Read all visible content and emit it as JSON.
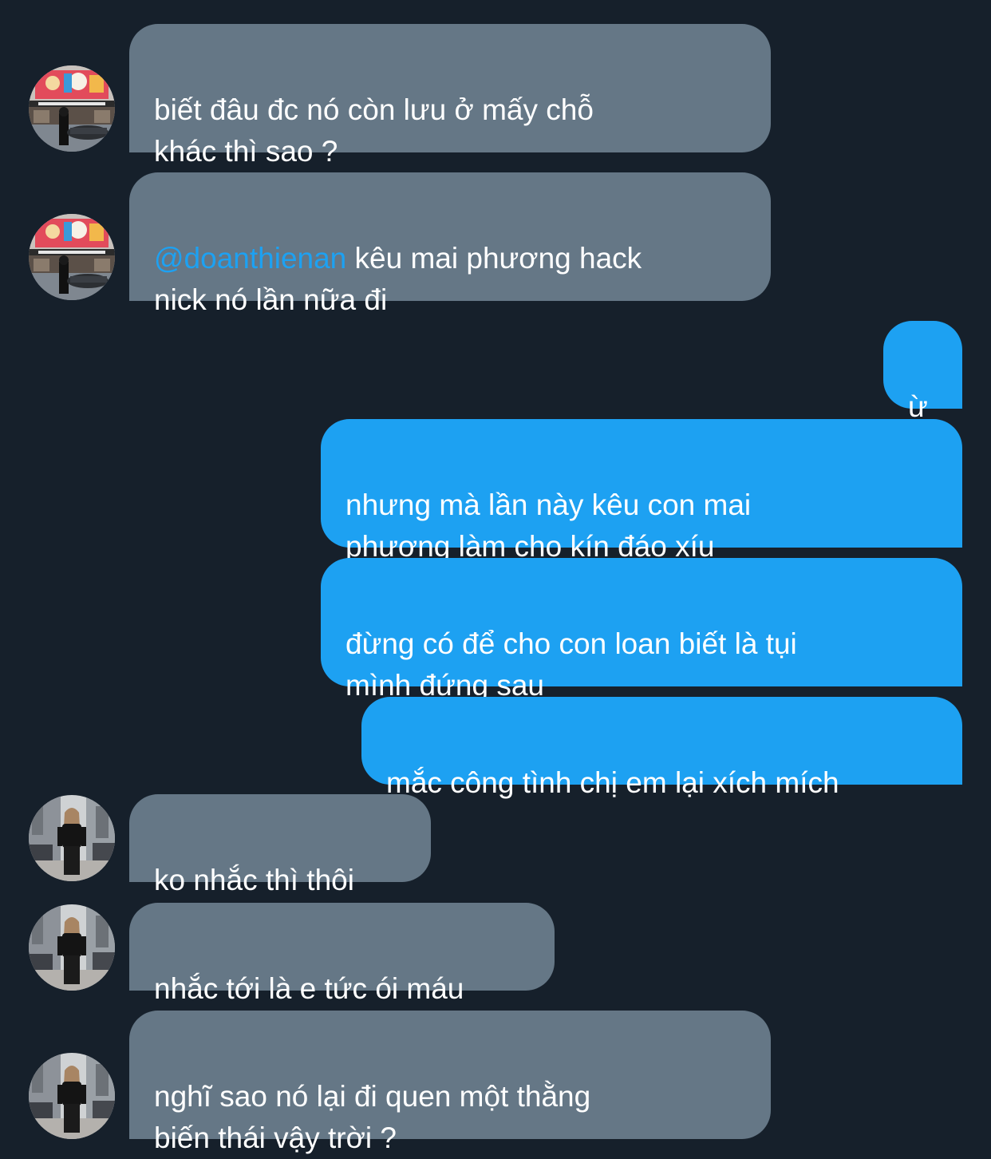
{
  "colors": {
    "background": "#16202b",
    "incoming_bubble": "#657786",
    "outgoing_bubble": "#1da1f2",
    "mention": "#1da1f2",
    "text": "#ffffff"
  },
  "messages": [
    {
      "direction": "incoming",
      "avatar": "avatar-storefront",
      "text": "biết đâu đc nó còn lưu ở mấy chỗ\nkhác thì sao ?"
    },
    {
      "direction": "incoming",
      "avatar": "avatar-storefront",
      "mention": "@doanthienan",
      "text": " kêu mai phương hack\nnick nó lần nữa đi"
    },
    {
      "direction": "outgoing",
      "text": "ừ"
    },
    {
      "direction": "outgoing",
      "text": "nhưng mà lần này kêu con mai\nphương làm cho kín đáo xíu"
    },
    {
      "direction": "outgoing",
      "text": "đừng có để cho con loan biết là tụi\nmình đứng sau"
    },
    {
      "direction": "outgoing",
      "text": "mắc công tình chị em lại xích mích"
    },
    {
      "direction": "incoming",
      "avatar": "avatar-woman-black-outfit",
      "text": "ko nhắc thì thôi"
    },
    {
      "direction": "incoming",
      "avatar": "avatar-woman-black-outfit",
      "text": "nhắc tới là e tức ói máu"
    },
    {
      "direction": "incoming",
      "avatar": "avatar-woman-black-outfit",
      "text": "nghĩ sao nó lại đi quen một thằng\nbiến thái vậy trời ?"
    }
  ]
}
